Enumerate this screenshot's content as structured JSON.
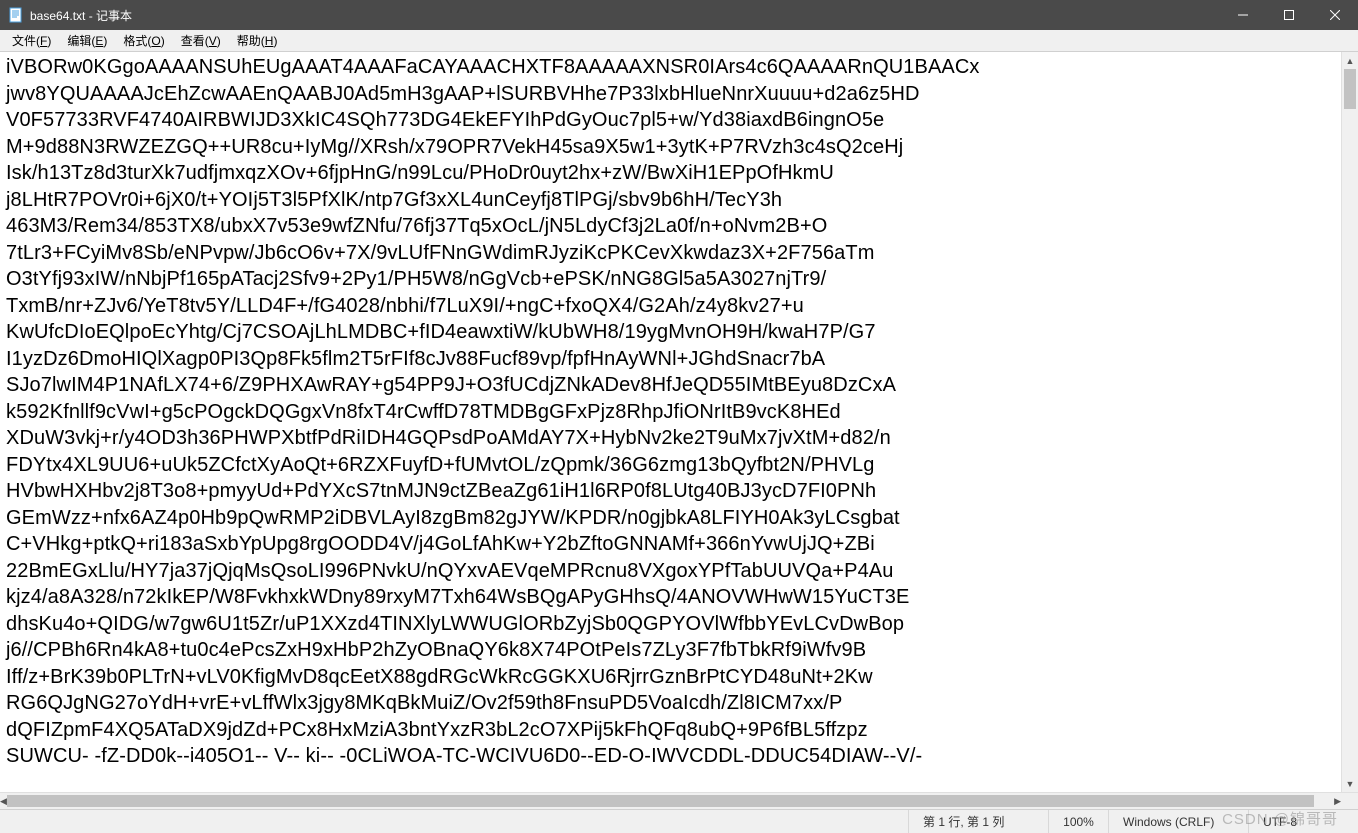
{
  "titlebar": {
    "title": "base64.txt - 记事本"
  },
  "menu": {
    "file": {
      "label": "文件",
      "accel": "F"
    },
    "edit": {
      "label": "编辑",
      "accel": "E"
    },
    "format": {
      "label": "格式",
      "accel": "O"
    },
    "view": {
      "label": "查看",
      "accel": "V"
    },
    "help": {
      "label": "帮助",
      "accel": "H"
    }
  },
  "content": {
    "lines": [
      "iVBORw0KGgoAAAANSUhEUgAAAT4AAAFaCAYAAACHXTF8AAAAAXNSR0IArs4c6QAAAARnQU1BAACx",
      "jwv8YQUAAAAJcEhZcwAAEnQAABJ0Ad5mH3gAAP+lSURBVHhe7P33lxbHlueNnrXuuuu+d2a6z5HD",
      "V0F57733RVF4740AIRBWIJD3XkIC4SQh773DG4EkEFYIhPdGyOuc7pl5+w/Yd38iaxdB6ingnO5e",
      "M+9d88N3RWZEZGQ++UR8cu+IyMg//XRsh/x79OPR7VekH45sa9X5w1+3ytK+P7RVzh3c4sQ2ceHj",
      "Isk/h13Tz8d3turXk7udfjmxqzXOv+6fjpHnG/n99Lcu/PHoDr0uyt2hx+zW/BwXiH1EPpOfHkmU",
      "j8LHtR7POVr0i+6jX0/t+YOIj5T3l5PfXlK/ntp7Gf3xXL4unCeyfj8TlPGj/sbv9b6hH/TecY3h",
      "463M3/Rem34/853TX8/ubxX7v53e9wfZNfu/76fj37Tq5xOcL/jN5LdyCf3j2La0f/n+oNvm2B+O",
      "7tLr3+FCyiMv8Sb/eNPvpw/Jb6cO6v+7X/9vLUfFNnGWdimRJyziKcPKCevXkwdaz3X+2F756aTm",
      "O3tYfj93xIW/nNbjPf165pATacj2Sfv9+2Py1/PH5W8/nGgVcb+ePSK/nNG8Gl5a5A3027njTr9/",
      "TxmB/nr+ZJv6/YeT8tv5Y/LLD4F+/fG4028/nbhi/f7LuX9I/+ngC+fxoQX4/G2Ah/z4y8kv27+u",
      "KwUfcDIoEQlpoEcYhtg/Cj7CSOAjLhLMDBC+fID4eawxtiW/kUbWH8/19ygMvnOH9H/kwaH7P/G7",
      "I1yzDz6DmoHIQlXagp0PI3Qp8Fk5flm2T5rFIf8cJv88Fucf89vp/fpfHnAyWNl+JGhdSnacr7bA",
      "SJo7lwIM4P1NAfLX74+6/Z9PHXAwRAY+g54PP9J+O3fUCdjZNkADev8HfJeQD55IMtBEyu8DzCxA",
      "k592Kfnllf9cVwI+g5cPOgckDQGgxVn8fxT4rCwffD78TMDBgGFxPjz8RhpJfiONrItB9vcK8HEd",
      "XDuW3vkj+r/y4OD3h36PHWPXbtfPdRiIDH4GQPsdPoAMdAY7X+HybNv2ke2T9uMx7jvXtM+d82/n",
      "FDYtx4XL9UU6+uUk5ZCfctXyAoQt+6RZXFuyfD+fUMvtOL/zQpmk/36G6zmg13bQyfbt2N/PHVLg",
      "HVbwHXHbv2j8T3o8+pmyyUd+PdYXcS7tnMJN9ctZBeaZg61iH1l6RP0f8LUtg40BJ3ycD7FI0PNh",
      "GEmWzz+nfx6AZ4p0Hb9pQwRMP2iDBVLAyI8zgBm82gJYW/KPDR/n0gjbkA8LFIYH0Ak3yLCsgbat",
      "C+VHkg+ptkQ+ri183aSxbYpUpg8rgOODD4V/j4GoLfAhKw+Y2bZftoGNNAMf+366nYvwUjJQ+ZBi",
      "22BmEGxLlu/HY7ja37jQjqMsQsoLI996PNvkU/nQYxvAEVqeMPRcnu8VXgoxYPfTabUUVQa+P4Au",
      "kjz4/a8A328/n72kIkEP/W8FvkhxkWDny89rxyM7Txh64WsBQgAPyGHhsQ/4ANOVWHwW15YuCT3E",
      "dhsKu4o+QIDG/w7gw6U1t5Zr/uP1XXzd4TINXlyLWWUGlORbZyjSb0QGPYOVlWfbbYEvLCvDwBop",
      "j6//CPBh6Rn4kA8+tu0c4ePcsZxH9xHbP2hZyOBnaQY6k8X74POtPeIs7ZLy3F7fbTbkRf9iWfv9B",
      "Iff/z+BrK39b0PLTrN+vLV0KfigMvD8qcEetX88gdRGcWkRcGGKXU6RjrrGznBrPtCYD48uNt+2Kw",
      "RG6QJgNG27oYdH+vrE+vLffWlx3jgy8MKqBkMuiZ/Ov2f59th8FnsuPD5VoaIcdh/Zl8ICM7xx/P",
      "dQFIZpmF4XQ5ATaDX9jdZd+PCx8HxMziA3bntYxzR3bL2cO7XPij5kFhQFq8ubQ+9P6fBL5ffzpz",
      "SUWCU- -fZ-DD0k--i405O1-- V-- ki-- -0CLiWOA-TC-WCIVU6D0--ED-O-IWVCDDL-DDUC54DIAW--V/-"
    ]
  },
  "statusbar": {
    "position": "第 1 行,  第 1 列",
    "zoom": "100%",
    "eol": "Windows (CRLF)",
    "encoding": "UTF-8"
  },
  "watermark": "CSDN @锦哥哥"
}
